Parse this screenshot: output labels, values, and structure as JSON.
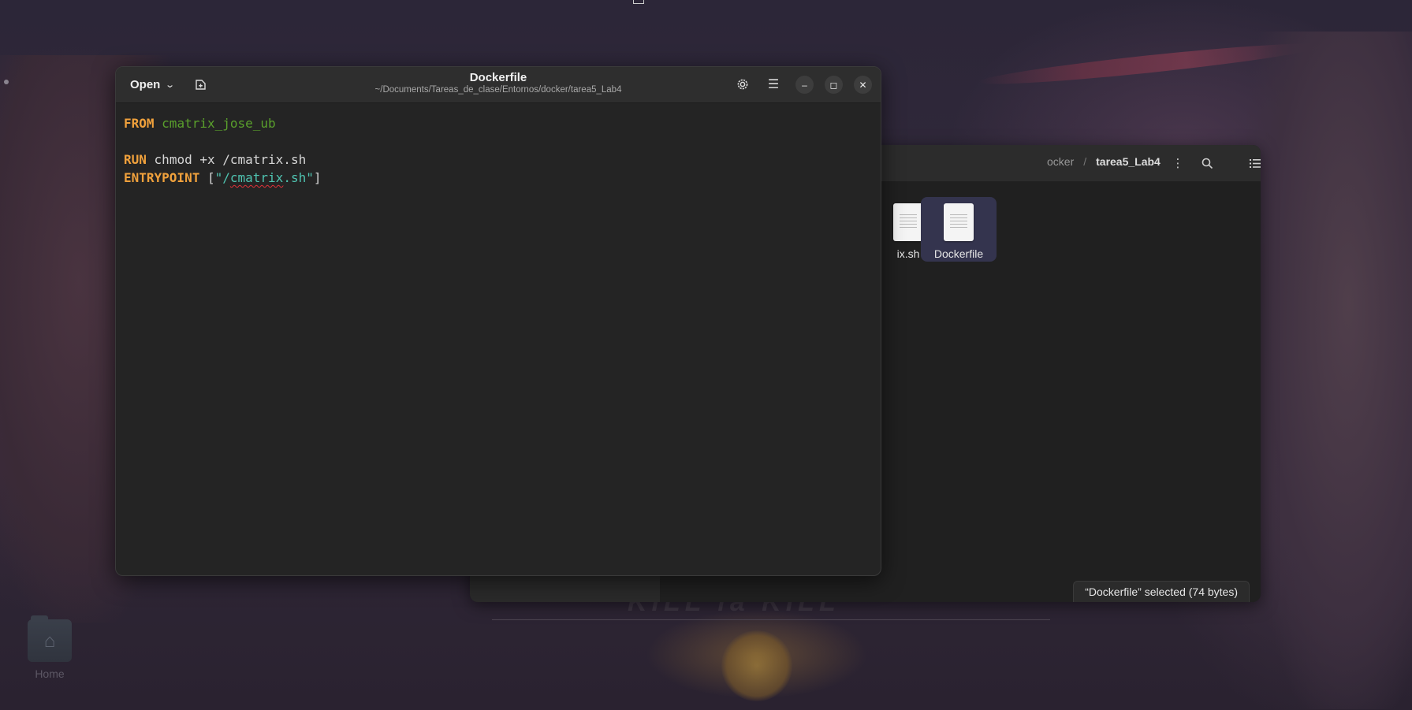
{
  "desktop": {
    "home_icon_label": "Home",
    "wallpaper_logo": "KILL la KILL"
  },
  "files": {
    "breadcrumb_prev": "docker",
    "breadcrumb_prev_visible": "ocker",
    "breadcrumb_current": "tarea5_Lab4",
    "items": [
      {
        "name": "cmatrix.sh",
        "visible_name": "ix.sh",
        "icon": "text-file-icon",
        "selected": false
      },
      {
        "name": "Dockerfile",
        "visible_name": "Dockerfile",
        "icon": "text-file-icon",
        "selected": true
      }
    ],
    "status": "“Dockerfile” selected  (74 bytes)"
  },
  "editor": {
    "open_label": "Open",
    "title": "Dockerfile",
    "path": "~/Documents/Tareas_de_clase/Entornos/docker/tarea5_Lab4",
    "code": {
      "l1_kw": "FROM",
      "l1_val": "cmatrix_jose_ub",
      "l3_kw": "RUN",
      "l3_val": "chmod +x /cmatrix.sh",
      "l4_kw": "ENTRYPOINT",
      "l4_open": "[",
      "l4_q1": "\"/",
      "l4_word": "cmatrix",
      "l4_q2": ".sh\"",
      "l4_close": "]"
    }
  },
  "colors": {
    "keyword": "#f0a13c",
    "image_name": "#5aa02c",
    "string": "#4fc3b0",
    "selection": "#34344e"
  }
}
